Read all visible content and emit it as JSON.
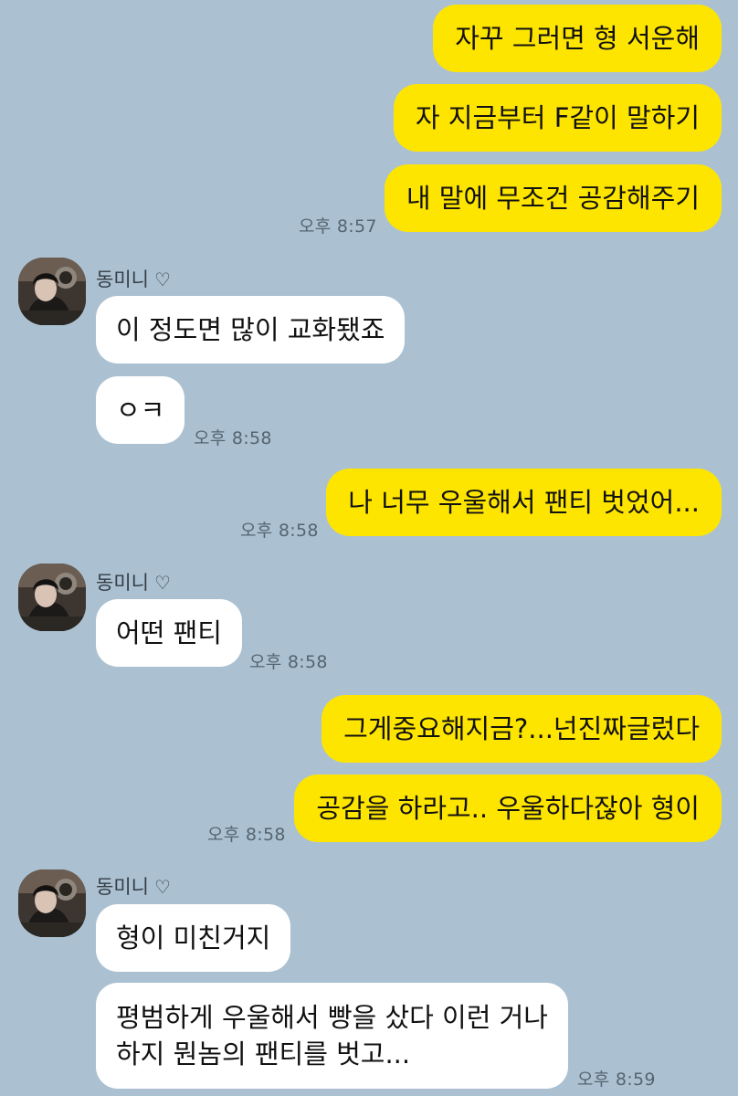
{
  "friend": {
    "name": "동미니",
    "heart": "♡"
  },
  "messages": {
    "m1": "자꾸 그러면 형 서운해",
    "m2": "자 지금부터 F같이 말하기",
    "m3": "내 말에 무조건 공감해주기",
    "t3": "오후 8:57",
    "f1": "이 정도면 많이 교화됐죠",
    "f2": "ㅇㅋ",
    "tf2": "오후 8:58",
    "m4": "나 너무 우울해서 팬티 벗었어...",
    "t4": "오후 8:58",
    "f3": "어떤 팬티",
    "tf3": "오후 8:58",
    "m5": "그게중요해지금?...넌진짜글렀다",
    "m6": "공감을 하라고.. 우울하다잖아 형이",
    "t6": "오후 8:58",
    "f4": "형이 미친거지",
    "f5": "평범하게 우울해서 빵을 샀다 이런 거나 하지 뭔놈의 팬티를 벗고...",
    "tf5": "오후 8:59"
  },
  "colors": {
    "background": "#abc1d1",
    "my_bubble": "#fee500",
    "friend_bubble": "#ffffff",
    "timestamp": "#556470"
  }
}
